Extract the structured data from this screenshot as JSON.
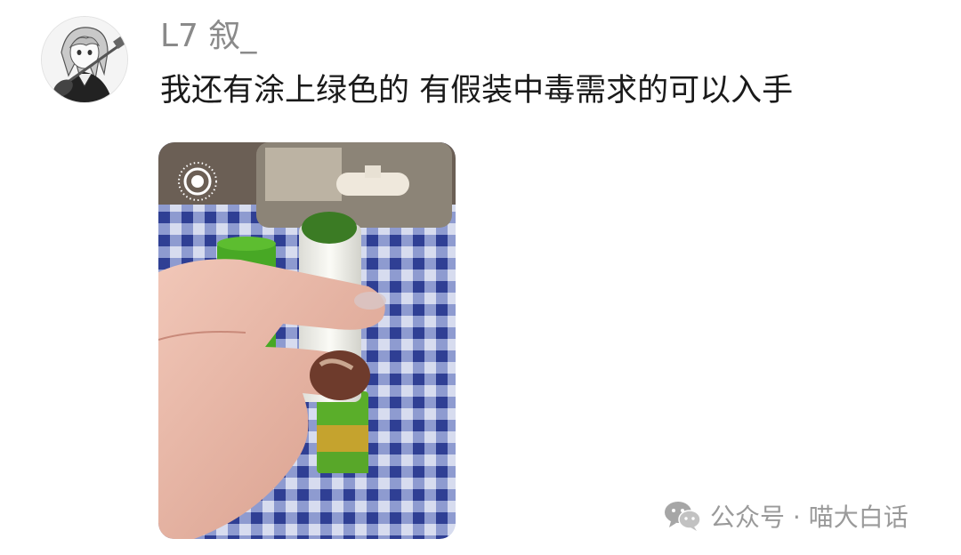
{
  "post": {
    "username": "L7 叙_",
    "message": "我还有涂上绿色的 有假装中毒需求的可以入手"
  },
  "photo": {
    "live_icon": "live-photo-icon"
  },
  "watermark": {
    "icon": "wechat-icon",
    "text": "公众号 · 喵大白话"
  }
}
